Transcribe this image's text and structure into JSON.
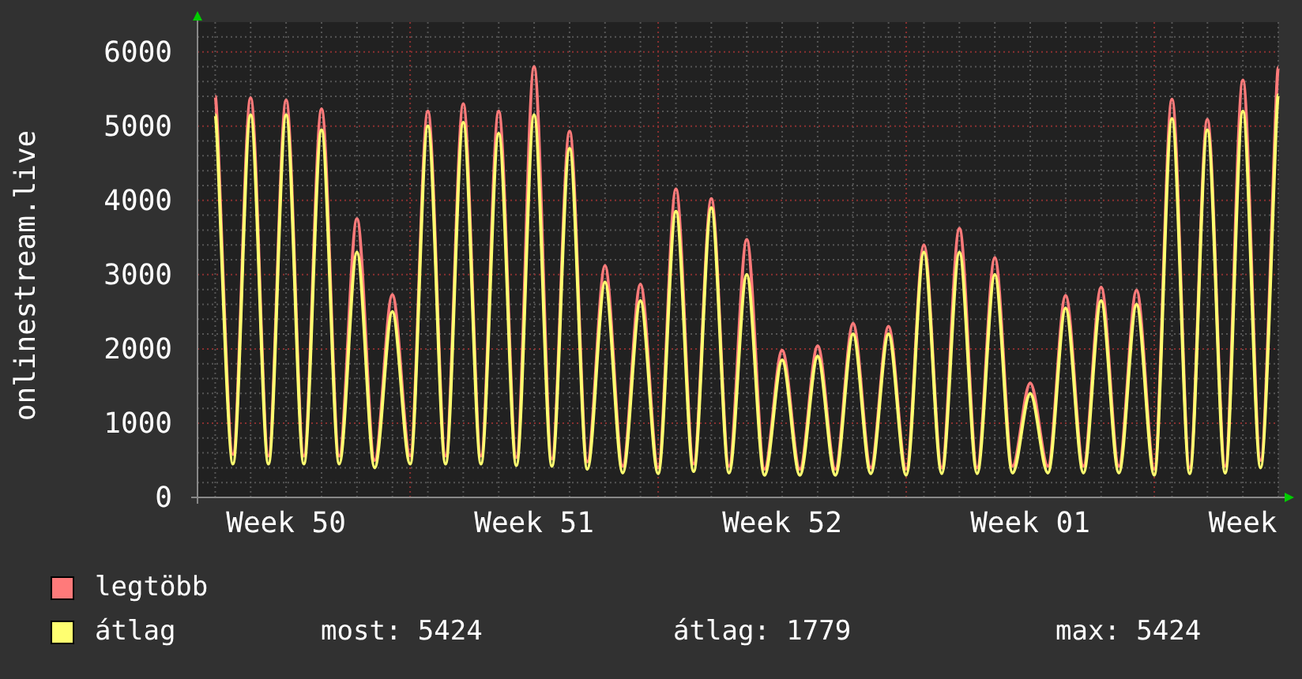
{
  "chart": {
    "chart_data": {
      "type": "line",
      "ylabel": "onlinestream.live",
      "categories": [
        null,
        null,
        null,
        null,
        null,
        "Week 50",
        null,
        null,
        null,
        null,
        null,
        null,
        null,
        null,
        null,
        null,
        null,
        null,
        null,
        "Week 51",
        null,
        null,
        null,
        null,
        null,
        null,
        null,
        null,
        null,
        null,
        null,
        null,
        null,
        "Week 52",
        null,
        null,
        null,
        null,
        null,
        null,
        null,
        null,
        null,
        null,
        null,
        null,
        null,
        "Week 01",
        null,
        null,
        null,
        null,
        null,
        null,
        null,
        null,
        null,
        null,
        null,
        "Week",
        null,
        null
      ],
      "series": [
        {
          "name": "legtöbb",
          "color": "#ff7a7a",
          "values": [
            null,
            5400,
            580,
            5380,
            560,
            5350,
            560,
            5230,
            560,
            3750,
            500,
            2730,
            560,
            5200,
            560,
            5300,
            560,
            5200,
            540,
            5800,
            520,
            4930,
            480,
            3120,
            420,
            2870,
            400,
            4150,
            450,
            4020,
            420,
            3470,
            380,
            1980,
            380,
            2040,
            380,
            2340,
            400,
            2300,
            380,
            3400,
            400,
            3620,
            400,
            3230,
            420,
            1540,
            420,
            2720,
            420,
            2830,
            420,
            2790,
            380,
            5360,
            400,
            5090,
            420,
            5620,
            500,
            5790
          ]
        },
        {
          "name": "átlag",
          "color": "#ffff70",
          "values": [
            null,
            5150,
            450,
            5150,
            450,
            5150,
            450,
            4950,
            450,
            3300,
            400,
            2500,
            450,
            5000,
            450,
            5050,
            450,
            4900,
            430,
            5150,
            420,
            4700,
            380,
            2900,
            330,
            2650,
            320,
            3850,
            350,
            3900,
            330,
            3000,
            300,
            1850,
            300,
            1900,
            300,
            2200,
            320,
            2200,
            300,
            3300,
            320,
            3300,
            320,
            3000,
            330,
            1400,
            330,
            2550,
            330,
            2650,
            330,
            2600,
            300,
            5100,
            320,
            4950,
            330,
            5200,
            400,
            5420
          ]
        }
      ],
      "ylim": [
        0,
        6400
      ],
      "grid": true,
      "yticks": [
        0,
        1000,
        2000,
        3000,
        4000,
        5000,
        6000
      ]
    }
  },
  "legend": {
    "stats": [
      "most: 5424",
      "átlag: 1779",
      "max: 5424"
    ]
  }
}
